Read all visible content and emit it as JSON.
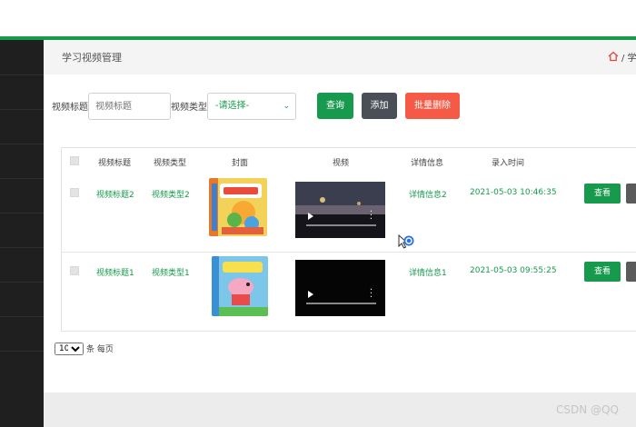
{
  "breadcrumb": {
    "title": "学习视频管理",
    "path": "/ 学习"
  },
  "search": {
    "title_label": "视频标题",
    "title_placeholder": "视频标题",
    "type_label": "视频类型",
    "type_selected": "-请选择-"
  },
  "buttons": {
    "query": "查询",
    "add": "添加",
    "batch_delete": "批量删除"
  },
  "table": {
    "headers": [
      "视频标题",
      "视频类型",
      "封面",
      "视频",
      "详情信息",
      "录入时间"
    ],
    "rows": [
      {
        "title": "视频标题2",
        "type": "视频类型2",
        "detail": "详情信息2",
        "time": "2021-05-03 10:46:35",
        "view": "查看"
      },
      {
        "title": "视频标题1",
        "type": "视频类型1",
        "detail": "详情信息1",
        "time": "2021-05-03 09:55:25",
        "view": "查看"
      }
    ]
  },
  "pagination": {
    "page_size": "10",
    "suffix": "条 每页"
  },
  "watermark": "CSDN @QQ",
  "colors": {
    "accent": "#179a4d",
    "add": "#4a4e57",
    "delete": "#f45a45",
    "sidebar": "#1f1f1f"
  },
  "icons": {
    "home": "home-icon",
    "cursor": "pointer-cursor-icon"
  }
}
